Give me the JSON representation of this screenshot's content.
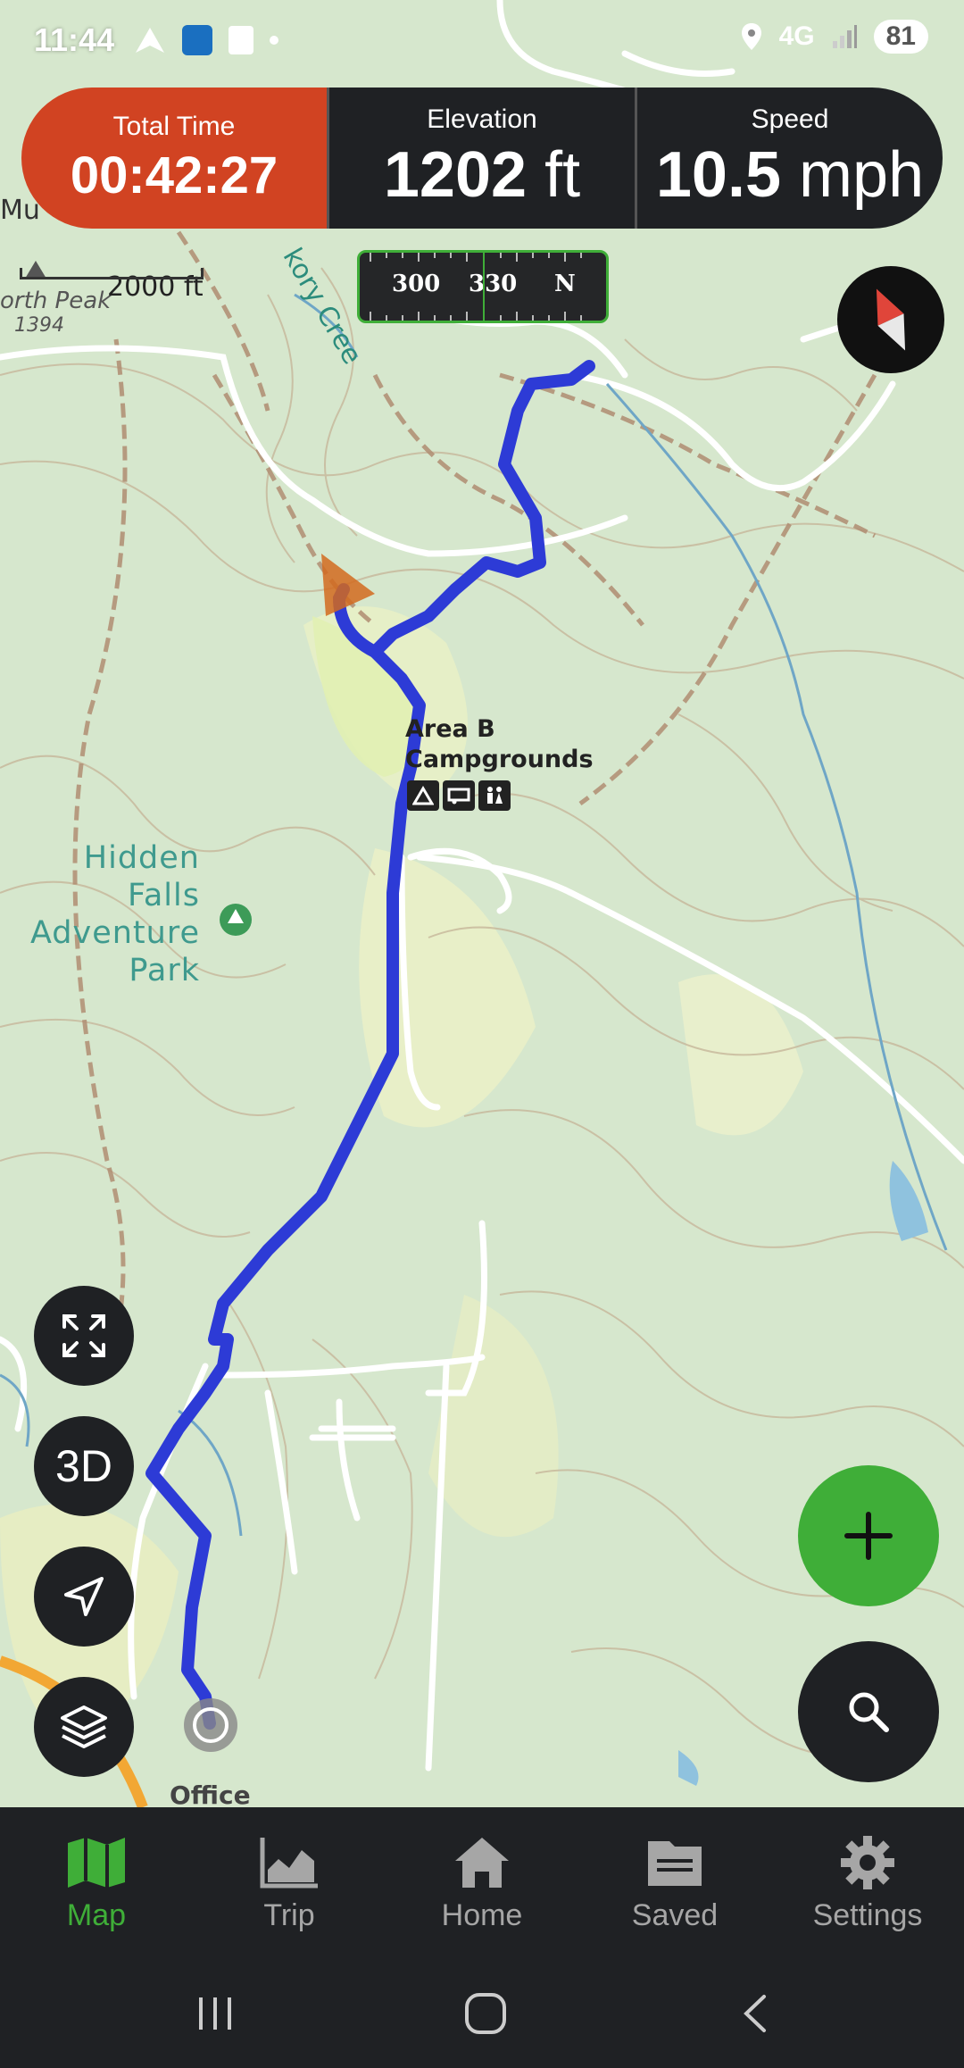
{
  "status_bar": {
    "time": "11:44",
    "network": "4G",
    "battery": "81"
  },
  "stats": {
    "total_time_label": "Total Time",
    "total_time_value": "00:42:27",
    "elevation_label": "Elevation",
    "elevation_value": "1202",
    "elevation_unit": "ft",
    "speed_label": "Speed",
    "speed_value": "10.5",
    "speed_unit": "mph"
  },
  "compass_strip": {
    "ticks": [
      "300",
      "330",
      "N"
    ]
  },
  "map": {
    "peak_name": "orth Peak",
    "peak_elevation": "1394",
    "scale_label": "2000 ft",
    "creek_label": "kory Cree",
    "creek_label_2": "Mu",
    "campground_label_1": "Area B",
    "campground_label_2": "Campgrounds",
    "park_label_1": "Hidden",
    "park_label_2": "Falls",
    "park_label_3": "Adventure",
    "park_label_4": "Park",
    "office_label": "Office"
  },
  "controls": {
    "three_d_label": "3D"
  },
  "bottom_nav": {
    "items": [
      {
        "label": "Map",
        "icon": "map-icon",
        "active": true
      },
      {
        "label": "Trip",
        "icon": "chart-icon",
        "active": false
      },
      {
        "label": "Home",
        "icon": "home-icon",
        "active": false
      },
      {
        "label": "Saved",
        "icon": "folder-icon",
        "active": false
      },
      {
        "label": "Settings",
        "icon": "gear-icon",
        "active": false
      }
    ]
  },
  "colors": {
    "accent_green": "#3fae38",
    "total_time_bg": "#d14322",
    "track_blue": "#2d3bd6",
    "bar_dark": "#1f2124"
  }
}
